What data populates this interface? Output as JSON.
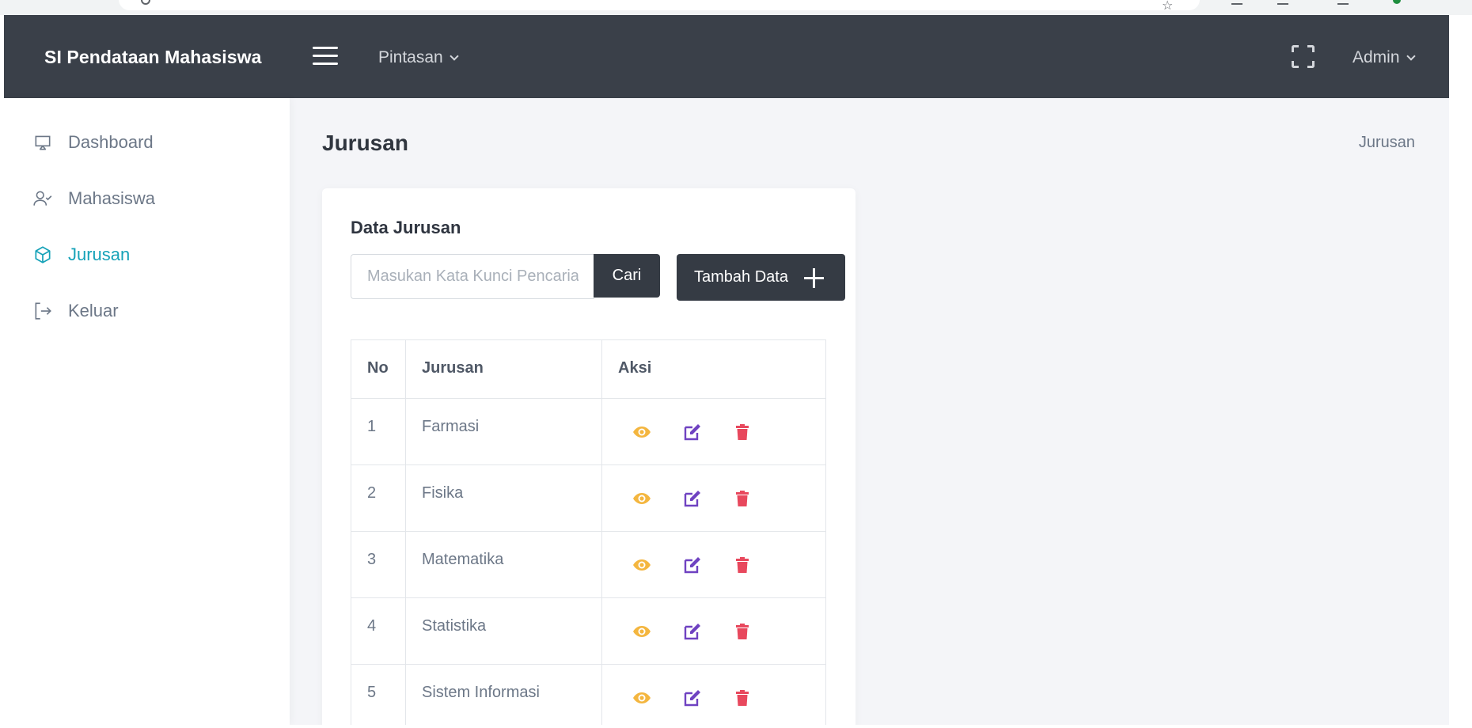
{
  "app": {
    "brand": "SI Pendataan Mahasiswa",
    "shortcut_label": "Pintasan",
    "user_label": "Admin"
  },
  "sidebar": {
    "items": [
      {
        "label": "Dashboard",
        "icon": "monitor-icon",
        "active": false
      },
      {
        "label": "Mahasiswa",
        "icon": "user-check-icon",
        "active": false
      },
      {
        "label": "Jurusan",
        "icon": "cube-icon",
        "active": true
      },
      {
        "label": "Keluar",
        "icon": "logout-icon",
        "active": false
      }
    ]
  },
  "page": {
    "title": "Jurusan",
    "breadcrumb": "Jurusan"
  },
  "card": {
    "title": "Data Jurusan",
    "search_placeholder": "Masukan Kata Kunci Pencarian",
    "search_button": "Cari",
    "add_button": "Tambah Data"
  },
  "table": {
    "headers": [
      "No",
      "Jurusan",
      "Aksi"
    ],
    "rows": [
      {
        "no": "1",
        "jurusan": "Farmasi"
      },
      {
        "no": "2",
        "jurusan": "Fisika"
      },
      {
        "no": "3",
        "jurusan": "Matematika"
      },
      {
        "no": "4",
        "jurusan": "Statistika"
      },
      {
        "no": "5",
        "jurusan": "Sistem Informasi"
      }
    ],
    "action_icons": [
      "eye-icon",
      "edit-icon",
      "trash-icon"
    ]
  },
  "colors": {
    "topbar": "#3a4049",
    "accent": "#16a2b8",
    "view": "#f4b63f",
    "edit": "#6f42c1",
    "delete": "#e8485d"
  }
}
